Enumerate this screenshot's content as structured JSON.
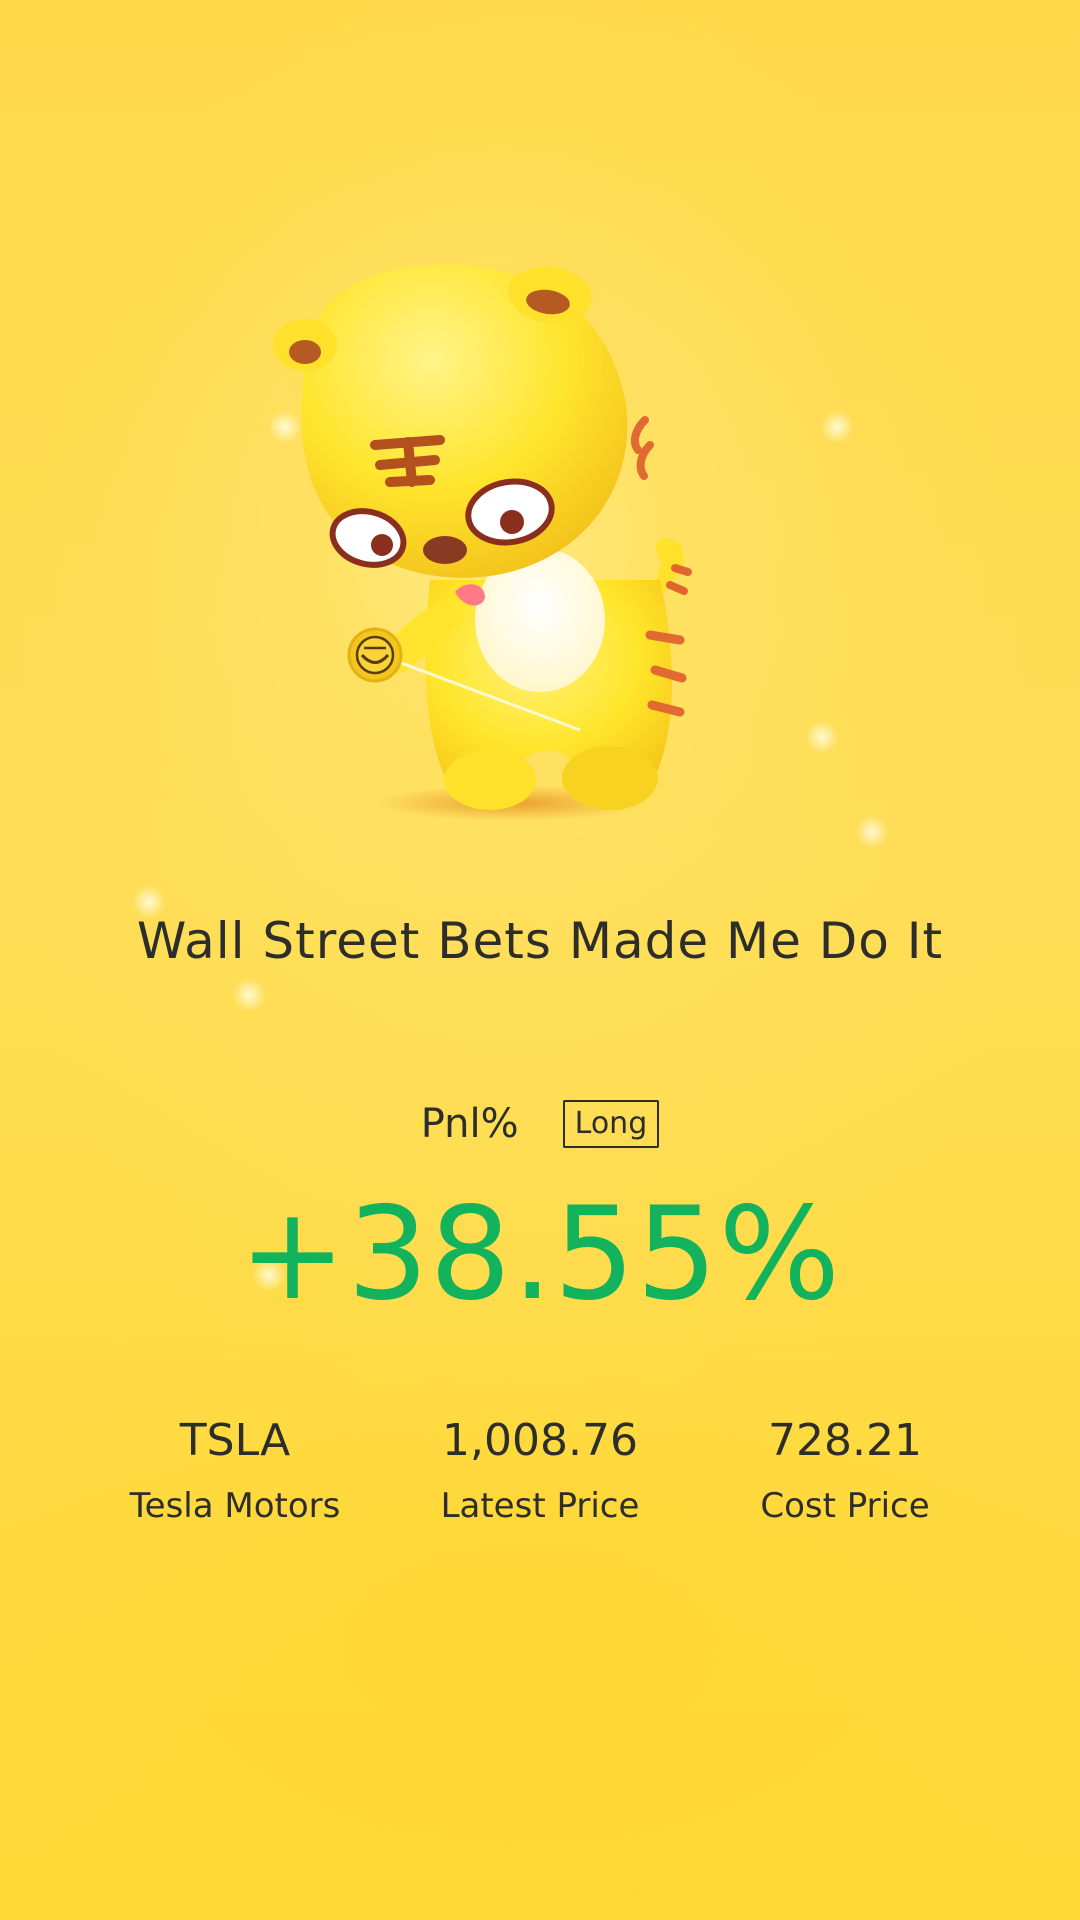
{
  "title": "Wall Street Bets Made Me Do It",
  "pnl": {
    "label": "Pnl%",
    "side": "Long",
    "value": "+38.55%"
  },
  "stock": {
    "symbol": "TSLA",
    "name": "Tesla Motors",
    "latest_price": "1,008.76",
    "latest_price_label": "Latest Price",
    "cost_price": "728.21",
    "cost_price_label": "Cost Price"
  },
  "colors": {
    "background": "#ffd94a",
    "text": "#2d2d2b",
    "gain": "#12b35c"
  },
  "icons": {
    "mascot": "tiger-mascot-illustration"
  }
}
